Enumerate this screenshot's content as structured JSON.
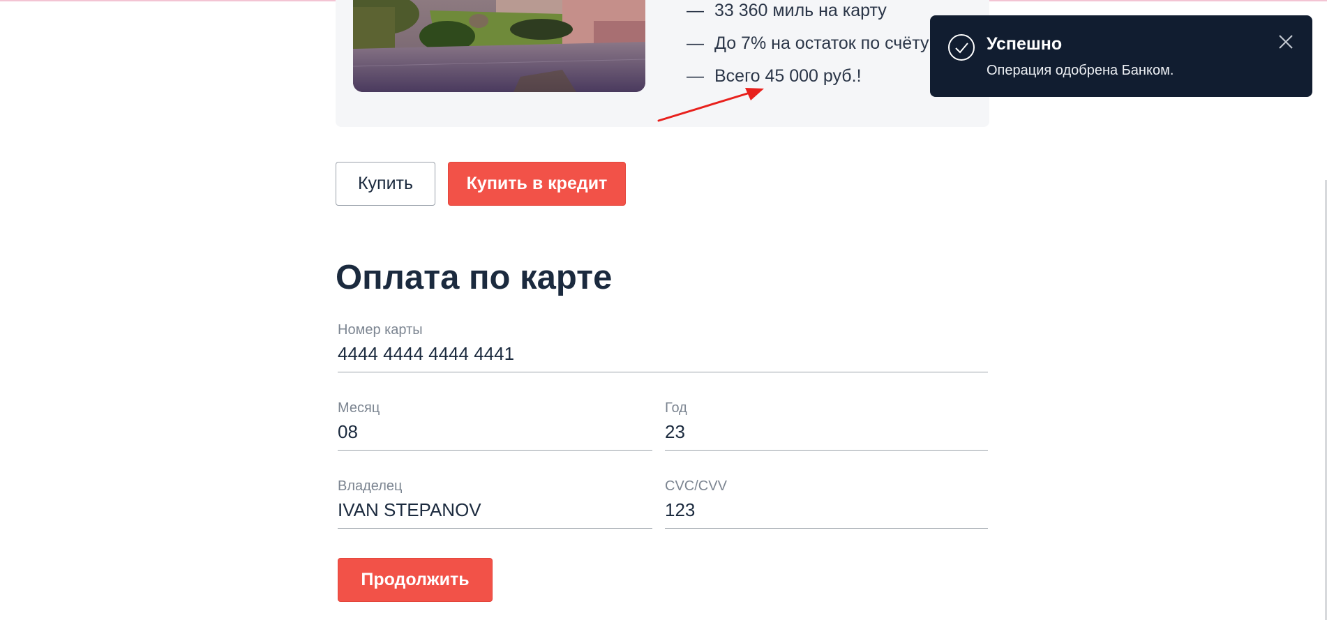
{
  "product": {
    "features": [
      "33 360 миль на карту",
      "До 7% на остаток по счёту",
      "Всего 45 000 руб.!"
    ],
    "dash": "—"
  },
  "actions": {
    "buy_label": "Купить",
    "credit_label": "Купить в кредит"
  },
  "payment": {
    "title": "Оплата по карте",
    "fields": {
      "card_number": {
        "label": "Номер карты",
        "value": "4444 4444 4444 4441"
      },
      "month": {
        "label": "Месяц",
        "value": "08"
      },
      "year": {
        "label": "Год",
        "value": "23"
      },
      "owner": {
        "label": "Владелец",
        "value": "IVAN STEPANOV"
      },
      "cvc": {
        "label": "CVC/CVV",
        "value": "123"
      }
    },
    "continue_label": "Продолжить"
  },
  "notification": {
    "title": "Успешно",
    "message": "Операция одобрена Банком.",
    "icon": "check-circle-icon",
    "close_icon": "close-icon"
  },
  "colors": {
    "accent": "#f25248",
    "toast_bg": "#111d30",
    "text": "#1b2a3e",
    "annotation_arrow": "#e8201c"
  }
}
